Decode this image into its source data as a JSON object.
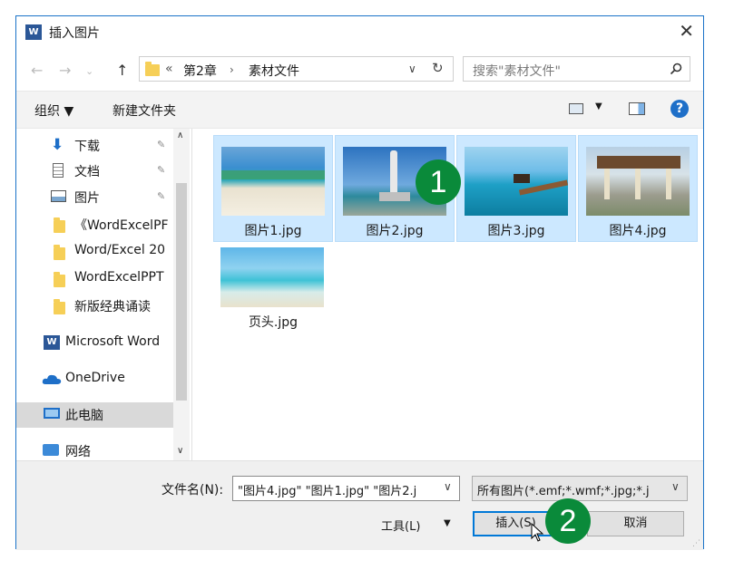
{
  "window": {
    "title": "插入图片",
    "app_badge": "W"
  },
  "address": {
    "overflow": "«",
    "crumbs": [
      "第2章",
      "素材文件"
    ],
    "search_placeholder": "搜索\"素材文件\""
  },
  "toolbar": {
    "organize": "组织 ▼",
    "new_folder": "新建文件夹",
    "help": "?"
  },
  "sidebar": {
    "items": [
      {
        "label": "下载"
      },
      {
        "label": "文档"
      },
      {
        "label": "图片"
      },
      {
        "label": "《WordExcelPF"
      },
      {
        "label": "Word/Excel 20"
      },
      {
        "label": "WordExcelPPT"
      },
      {
        "label": "新版经典诵读"
      },
      {
        "label": "Microsoft Word"
      },
      {
        "label": "OneDrive"
      },
      {
        "label": "此电脑"
      },
      {
        "label": "网络"
      }
    ]
  },
  "files": [
    {
      "name": "图片1.jpg",
      "selected": true
    },
    {
      "name": "图片2.jpg",
      "selected": true
    },
    {
      "name": "图片3.jpg",
      "selected": true
    },
    {
      "name": "图片4.jpg",
      "selected": true
    },
    {
      "name": "页头.jpg",
      "selected": false
    }
  ],
  "footer": {
    "filename_label": "文件名(N):",
    "filename_value": "\"图片4.jpg\" \"图片1.jpg\" \"图片2.j",
    "filetype_value": "所有图片(*.emf;*.wmf;*.jpg;*.j",
    "tools": "工具(L)",
    "insert": "插入(S)",
    "cancel": "取消"
  },
  "callouts": [
    "1",
    "2"
  ]
}
